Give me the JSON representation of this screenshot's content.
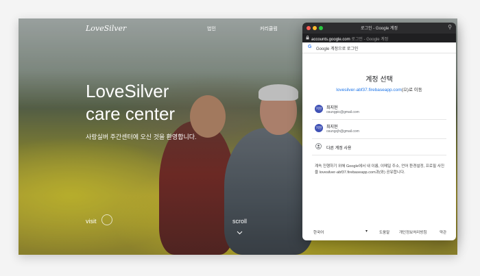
{
  "site": {
    "logo": "LoveSilver",
    "nav": [
      "법인",
      "커리큘럼"
    ],
    "title_line1": "LoveSilver",
    "title_line2": "care center",
    "subtitle": "사랑실버 주간센터에 오신 것을 환영합니다.",
    "visit": "visit",
    "scroll": "scroll",
    "scroll_icon": "chevron-down-icon"
  },
  "popup": {
    "window_title": "로그인 - Google 계정",
    "url_domain": "accounts.google.com",
    "url_rest": "로그인 - Google 계정",
    "google_bar_text": "Google 계정으로 로그인",
    "heading": "계정 선택",
    "destination_link": "lovesilver-abf37.firebaseapp.com",
    "destination_suffix": "(으)로 이동",
    "accounts": [
      {
        "avatar": "지현",
        "name": "최지현",
        "email": "osungpic@gmail.com"
      },
      {
        "avatar": "지현",
        "name": "최지현",
        "email": "osungcjh@gmail.com"
      }
    ],
    "other_account": "다른 계정 사용",
    "consent": "계속 진행하기 위해 Google에서 내 이름, 이메일 주소, 언어 환경설정, 프로필 사진을 lovesilver-abf37.firebaseapp.com과(와) 공유합니다.",
    "footer": {
      "language": "한국어",
      "help": "도움말",
      "privacy": "개인정보처리방침",
      "terms": "약관"
    },
    "colors": {
      "close": "#ff5f57",
      "minimize": "#febc2e",
      "zoom": "#28c840",
      "link": "#1a73e8"
    }
  }
}
